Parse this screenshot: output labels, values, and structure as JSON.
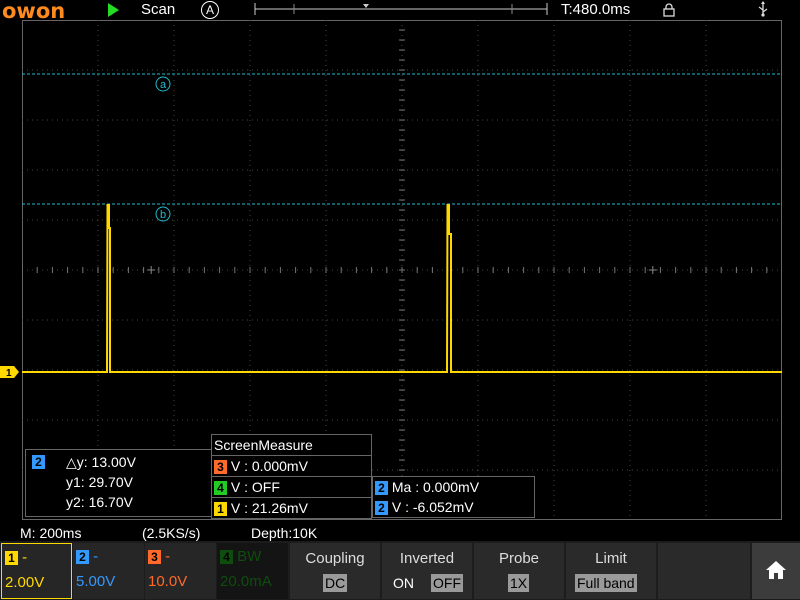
{
  "topbar": {
    "logo": "owon",
    "run_state_icon": "play-icon",
    "mode": "Scan",
    "trigger_mode": "A",
    "timebase_position": "T:480.0ms",
    "lock_icon": "lock-icon",
    "usb_icon": "usb-icon"
  },
  "colors": {
    "ch1": "#ffd800",
    "ch2": "#3399ff",
    "ch3": "#ff6a2a",
    "ch4": "#22cc22",
    "cursor": "#22bbcc",
    "grid": "#555555"
  },
  "cursors": {
    "a_label": "a",
    "b_label": "b"
  },
  "cursor_measure": {
    "channel": "2",
    "dy": "△y: 13.00V",
    "y1": "y1: 29.70V",
    "y2": "y2: 16.70V"
  },
  "screen_measure": {
    "title": "ScreenMeasure",
    "rows": [
      {
        "channel": "3",
        "text": "V : 0.000mV"
      },
      {
        "channel": "4",
        "text": "V : OFF"
      },
      {
        "channel": "1",
        "text": "V : 21.26mV"
      }
    ],
    "extra_rows": [
      {
        "channel": "2",
        "text": "Ma : 0.000mV"
      },
      {
        "channel": "2",
        "text": "V : -6.052mV"
      }
    ]
  },
  "status": {
    "timebase": "M: 200ms",
    "sample_rate": "(2.5KS/s)",
    "depth": "Depth:10K"
  },
  "channels": [
    {
      "num": "1",
      "coupling": "-",
      "scale": "2.00V"
    },
    {
      "num": "2",
      "coupling": "-",
      "scale": "5.00V"
    },
    {
      "num": "3",
      "coupling": "-",
      "scale": "10.0V"
    },
    {
      "num": "4",
      "coupling": "BW",
      "scale": "20.0mA"
    }
  ],
  "menu": {
    "coupling": {
      "label": "Coupling",
      "option": "DC"
    },
    "inverted": {
      "label": "Inverted",
      "on": "ON",
      "off": "OFF"
    },
    "probe": {
      "label": "Probe",
      "option": "1X"
    },
    "limit": {
      "label": "Limit",
      "option": "Full band"
    },
    "home_icon": "home-icon"
  },
  "ch1_marker": "1"
}
